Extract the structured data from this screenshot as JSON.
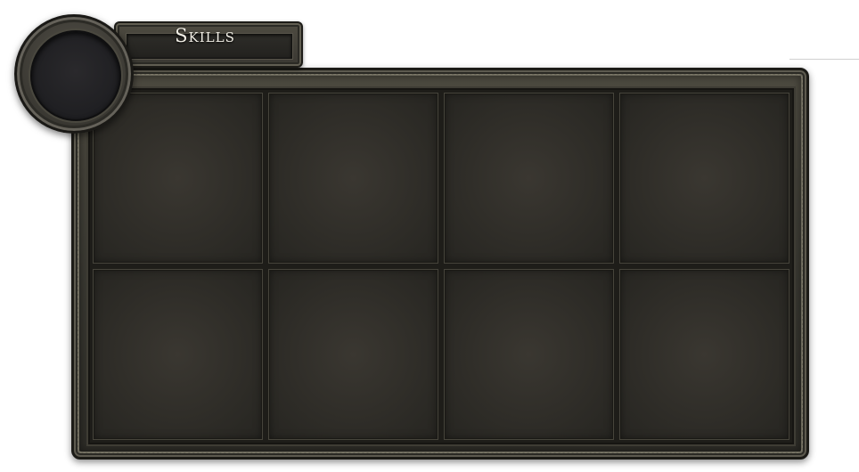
{
  "window": {
    "title": "Skills"
  },
  "skills_panel": {
    "columns": 4,
    "rows": 2,
    "slots": [
      {
        "index": 1,
        "state": "empty"
      },
      {
        "index": 2,
        "state": "empty"
      },
      {
        "index": 3,
        "state": "empty"
      },
      {
        "index": 4,
        "state": "empty"
      },
      {
        "index": 5,
        "state": "empty"
      },
      {
        "index": 6,
        "state": "empty"
      },
      {
        "index": 7,
        "state": "empty"
      },
      {
        "index": 8,
        "state": "empty"
      }
    ]
  },
  "medallion": {
    "icon": "empty-portrait-socket",
    "state": "empty"
  },
  "colors": {
    "frame": "#3b3a33",
    "slot": "#2f2d28",
    "socket": "#1f1f22",
    "title_text": "#f2efe6"
  }
}
